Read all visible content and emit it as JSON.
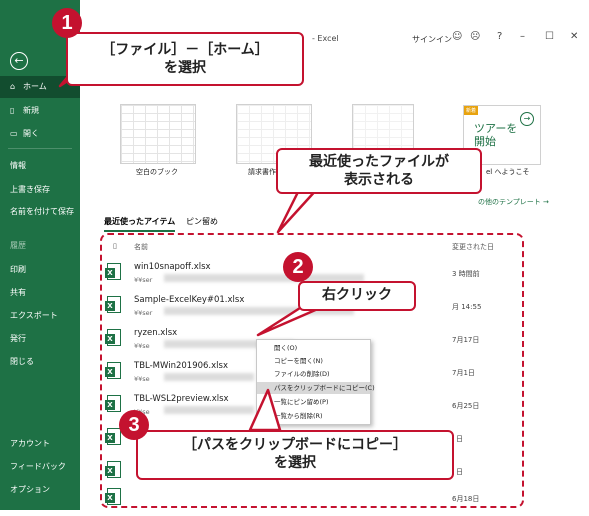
{
  "window": {
    "title": "- Excel",
    "signin": "サインイン"
  },
  "sidebar": {
    "items": [
      {
        "label": "ホーム",
        "icon": "home-icon"
      },
      {
        "label": "新規",
        "icon": "new-file-icon"
      },
      {
        "label": "開く",
        "icon": "open-folder-icon"
      },
      {
        "label": "情報"
      },
      {
        "label": "上書き保存"
      },
      {
        "label": "名前を付けて保存"
      },
      {
        "label": "履歴"
      },
      {
        "label": "印刷"
      },
      {
        "label": "共有"
      },
      {
        "label": "エクスポート"
      },
      {
        "label": "発行"
      },
      {
        "label": "閉じる"
      },
      {
        "label": "アカウント"
      },
      {
        "label": "フィードバック"
      },
      {
        "label": "オプション"
      }
    ]
  },
  "templates": {
    "blank_label": "空白のブック",
    "invoice_label": "請求書作",
    "tour_tag": "新着",
    "tour_line1": "ツアーを",
    "tour_line2": "開始",
    "welcome_label": "el へようこそ",
    "more_label": "の他のテンプレート →"
  },
  "tabs": {
    "recent": "最近使ったアイテム",
    "pinned": "ピン留め"
  },
  "headers": {
    "name": "名前",
    "date": "変更された日"
  },
  "files": [
    {
      "name": "win10snapoff.xlsx",
      "path": "¥¥ser",
      "date": "3 時間前"
    },
    {
      "name": "Sample-ExcelKey#01.xlsx",
      "path": "¥¥ser",
      "date": "月 14:55"
    },
    {
      "name": "ryzen.xlsx",
      "path": "¥¥se",
      "date": "7月17日"
    },
    {
      "name": "TBL-MWin201906.xlsx",
      "path": "¥¥se",
      "date": "7月1日"
    },
    {
      "name": "TBL-WSL2preview.xlsx",
      "path": "¥¥se",
      "date": "6月25日"
    },
    {
      "name": "",
      "path": "",
      "date": "日"
    },
    {
      "name": "",
      "path": "",
      "date": "日"
    },
    {
      "name": "",
      "path": "",
      "date": "6月18日"
    }
  ],
  "context_menu": [
    "開く(O)",
    "コピーを開く(N)",
    "ファイルの削除(D)",
    "パスをクリップボードにコピー(C)",
    "一覧にピン留め(P)",
    "一覧から削除(R)"
  ],
  "annotations": {
    "step1_number": "1",
    "step1_line1": "［ファイル］－［ホーム］",
    "step1_line2": "を選択",
    "recent_line1": "最近使ったファイルが",
    "recent_line2": "表示される",
    "step2_number": "2",
    "step2_text": "右クリック",
    "step3_number": "3",
    "step3_line1": "［パスをクリップボードにコピー］",
    "step3_line2": "を選択"
  },
  "colors": {
    "excel_green": "#1e7145",
    "annotation_red": "#c4122f",
    "context_highlight": "#d8d8d8"
  }
}
